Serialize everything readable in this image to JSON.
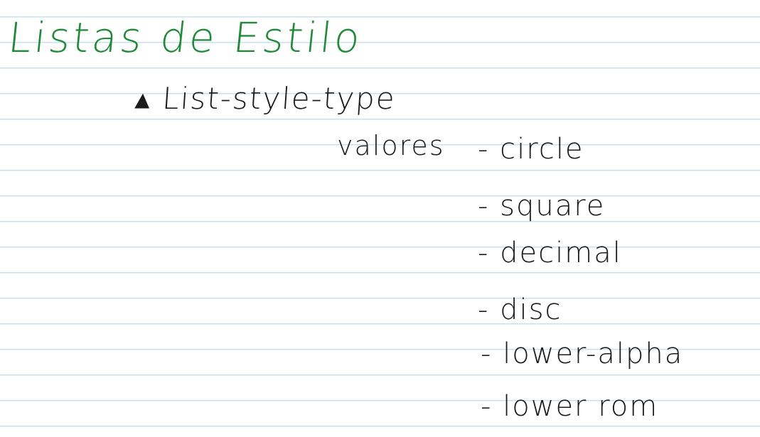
{
  "note": {
    "title": "Listas de Estilo",
    "property": "▴ List-style-type",
    "values_label": "valores",
    "values": [
      "- circle",
      "- square",
      "- decimal",
      "- disc",
      "- lower-alpha",
      "- lower rom"
    ]
  },
  "colors": {
    "title_ink": "#1f8a37",
    "body_ink": "#1b1b1b",
    "ruled_lines": "#c9e2f2",
    "paper": "#ffffff"
  }
}
